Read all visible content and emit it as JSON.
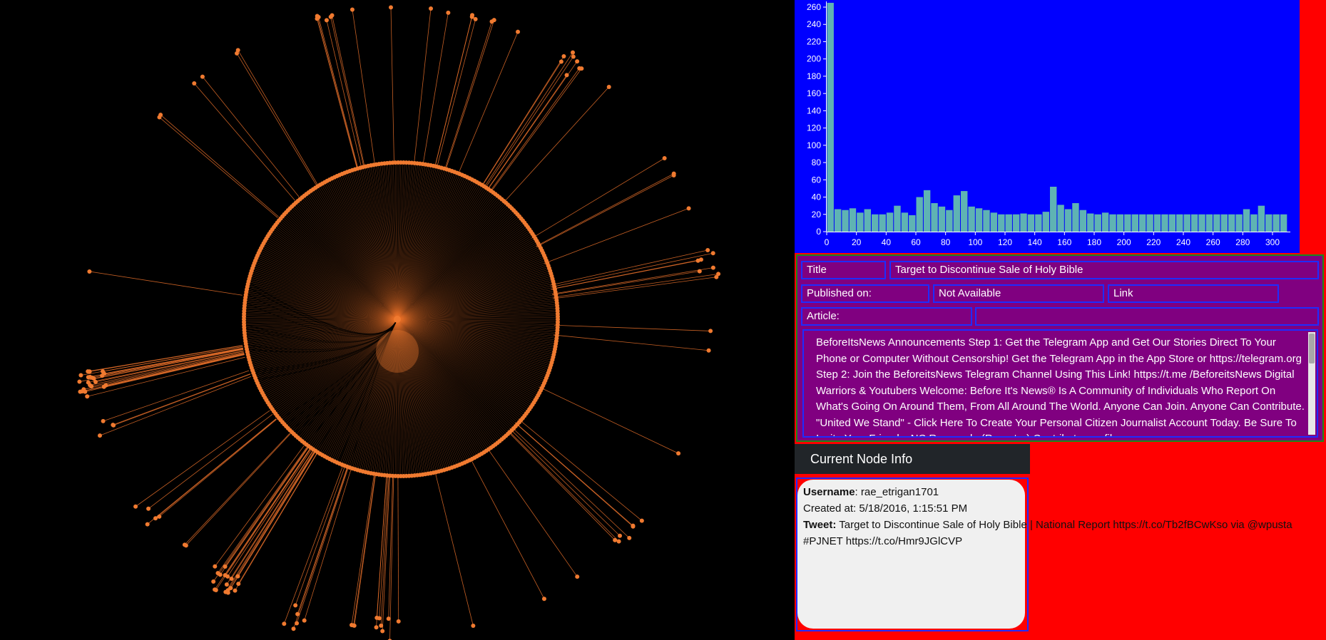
{
  "graph": {
    "edge_color": "#e8702a",
    "node_color": "#f07a30",
    "background": "#000000"
  },
  "histogram": {
    "background": "#0000ff",
    "bar_color": "#5fb3b3",
    "text_color": "#ffffff",
    "y_ticks": [
      "0",
      "20",
      "40",
      "60",
      "80",
      "100",
      "120",
      "140",
      "160",
      "180",
      "200",
      "220",
      "240",
      "260"
    ],
    "x_ticks": [
      "0",
      "20",
      "40",
      "60",
      "80",
      "100",
      "120",
      "140",
      "160",
      "180",
      "200",
      "220",
      "240",
      "260",
      "280",
      "300"
    ]
  },
  "chart_data": {
    "type": "bar",
    "title": "",
    "xlabel": "",
    "ylabel": "",
    "xlim": [
      0,
      312
    ],
    "ylim": [
      0,
      260
    ],
    "bin_width": 5,
    "x": [
      0,
      5,
      10,
      15,
      20,
      25,
      30,
      35,
      40,
      45,
      50,
      55,
      60,
      65,
      70,
      75,
      80,
      85,
      90,
      95,
      100,
      105,
      110,
      115,
      120,
      125,
      130,
      135,
      140,
      145,
      150,
      155,
      160,
      165,
      170,
      175,
      180,
      185,
      190,
      195,
      200,
      205,
      210,
      215,
      220,
      225,
      230,
      235,
      240,
      245,
      250,
      255,
      260,
      265,
      270,
      275,
      280,
      285,
      290,
      295,
      300,
      305
    ],
    "values": [
      265,
      26,
      25,
      27,
      22,
      26,
      20,
      20,
      22,
      30,
      22,
      19,
      40,
      48,
      33,
      29,
      25,
      42,
      47,
      29,
      27,
      25,
      22,
      20,
      20,
      20,
      21,
      20,
      20,
      23,
      52,
      31,
      26,
      33,
      25,
      21,
      20,
      22,
      20,
      20,
      20,
      20,
      20,
      20,
      20,
      20,
      20,
      20,
      20,
      20,
      20,
      20,
      20,
      20,
      20,
      20,
      26,
      20,
      30,
      20,
      20,
      20
    ]
  },
  "info": {
    "title_label": "Title",
    "title_value": "Target to Discontinue Sale of Holy Bible",
    "published_label": "Published on:",
    "published_value": "Not Available",
    "link_label": "Link",
    "article_label": "Article:",
    "article_text": "BeforeItsNews Announcements Step 1: Get the Telegram App and Get Our Stories Direct To Your Phone or Computer Without Censorship! Get the Telegram App in the App Store or https://telegram.org Step 2: Join the BeforeitsNews Telegram Channel Using This Link! https://t.me /BeforeitsNews Digital Warriors & Youtubers Welcome: Before It's News® Is A Community of Individuals Who Report On What's Going On Around Them, From All Around The World. Anyone Can Join. Anyone Can Contribute. \"United We Stand\" - Click Here To Create Your Personal Citizen Journalist Account Today. Be Sure To Invite Your Friends. NC Renegade (Reporter) Contributor profile"
  },
  "node_info": {
    "header": "Current Node Info",
    "username_label": "Username",
    "username_value": ": rae_etrigan1701",
    "created": "Created at: 5/18/2016, 1:15:51 PM",
    "tweet_label": "Tweet:",
    "tweet_value": " Target to Discontinue Sale of Holy Bible | National Report https://t.co/Tb2fBCwKso via @wpusta",
    "tweet_line2": "#PJNET https://t.co/Hmr9JGlCVP"
  }
}
